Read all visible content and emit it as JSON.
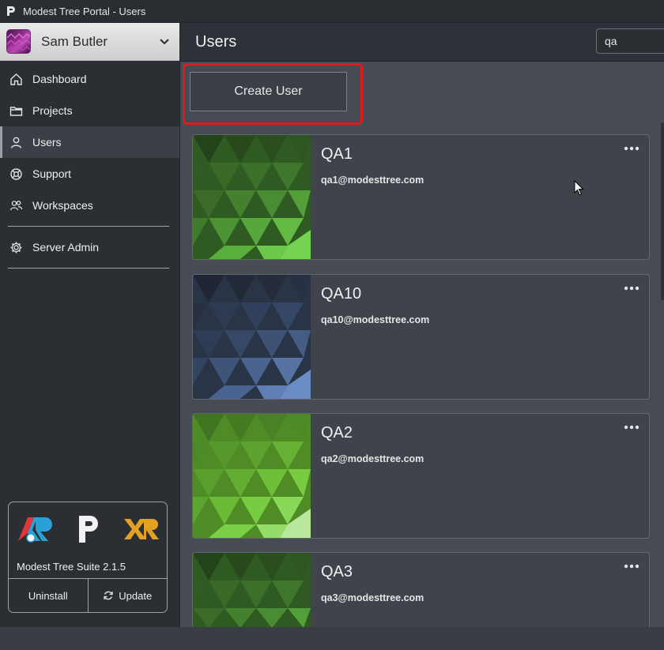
{
  "window": {
    "title": "Modest Tree Portal - Users"
  },
  "user_menu": {
    "name": "Sam Butler"
  },
  "nav": {
    "items": [
      {
        "label": "Dashboard",
        "icon": "home-icon"
      },
      {
        "label": "Projects",
        "icon": "folder-icon"
      },
      {
        "label": "Users",
        "icon": "user-icon",
        "active": true
      },
      {
        "label": "Support",
        "icon": "lifebuoy-icon"
      },
      {
        "label": "Workspaces",
        "icon": "users-icon"
      }
    ],
    "admin": {
      "label": "Server Admin",
      "icon": "gear-icon"
    }
  },
  "suite": {
    "label": "Modest Tree Suite 2.1.5",
    "uninstall_label": "Uninstall",
    "update_label": "Update"
  },
  "header": {
    "title": "Users"
  },
  "search": {
    "value": "qa"
  },
  "toolbar": {
    "create_label": "Create User"
  },
  "users": [
    {
      "name": "QA1",
      "email": "qa1@modesttree.com",
      "theme": "green"
    },
    {
      "name": "QA10",
      "email": "qa10@modesttree.com",
      "theme": "blue"
    },
    {
      "name": "QA2",
      "email": "qa2@modesttree.com",
      "theme": "lime"
    },
    {
      "name": "QA3",
      "email": "qa3@modesttree.com",
      "theme": "green"
    }
  ],
  "colors": {
    "accent_highlight": "#e01b1b",
    "sidebar_bg": "#2b2f34",
    "main_bg": "#474c54",
    "card_bg": "#3f444b"
  }
}
